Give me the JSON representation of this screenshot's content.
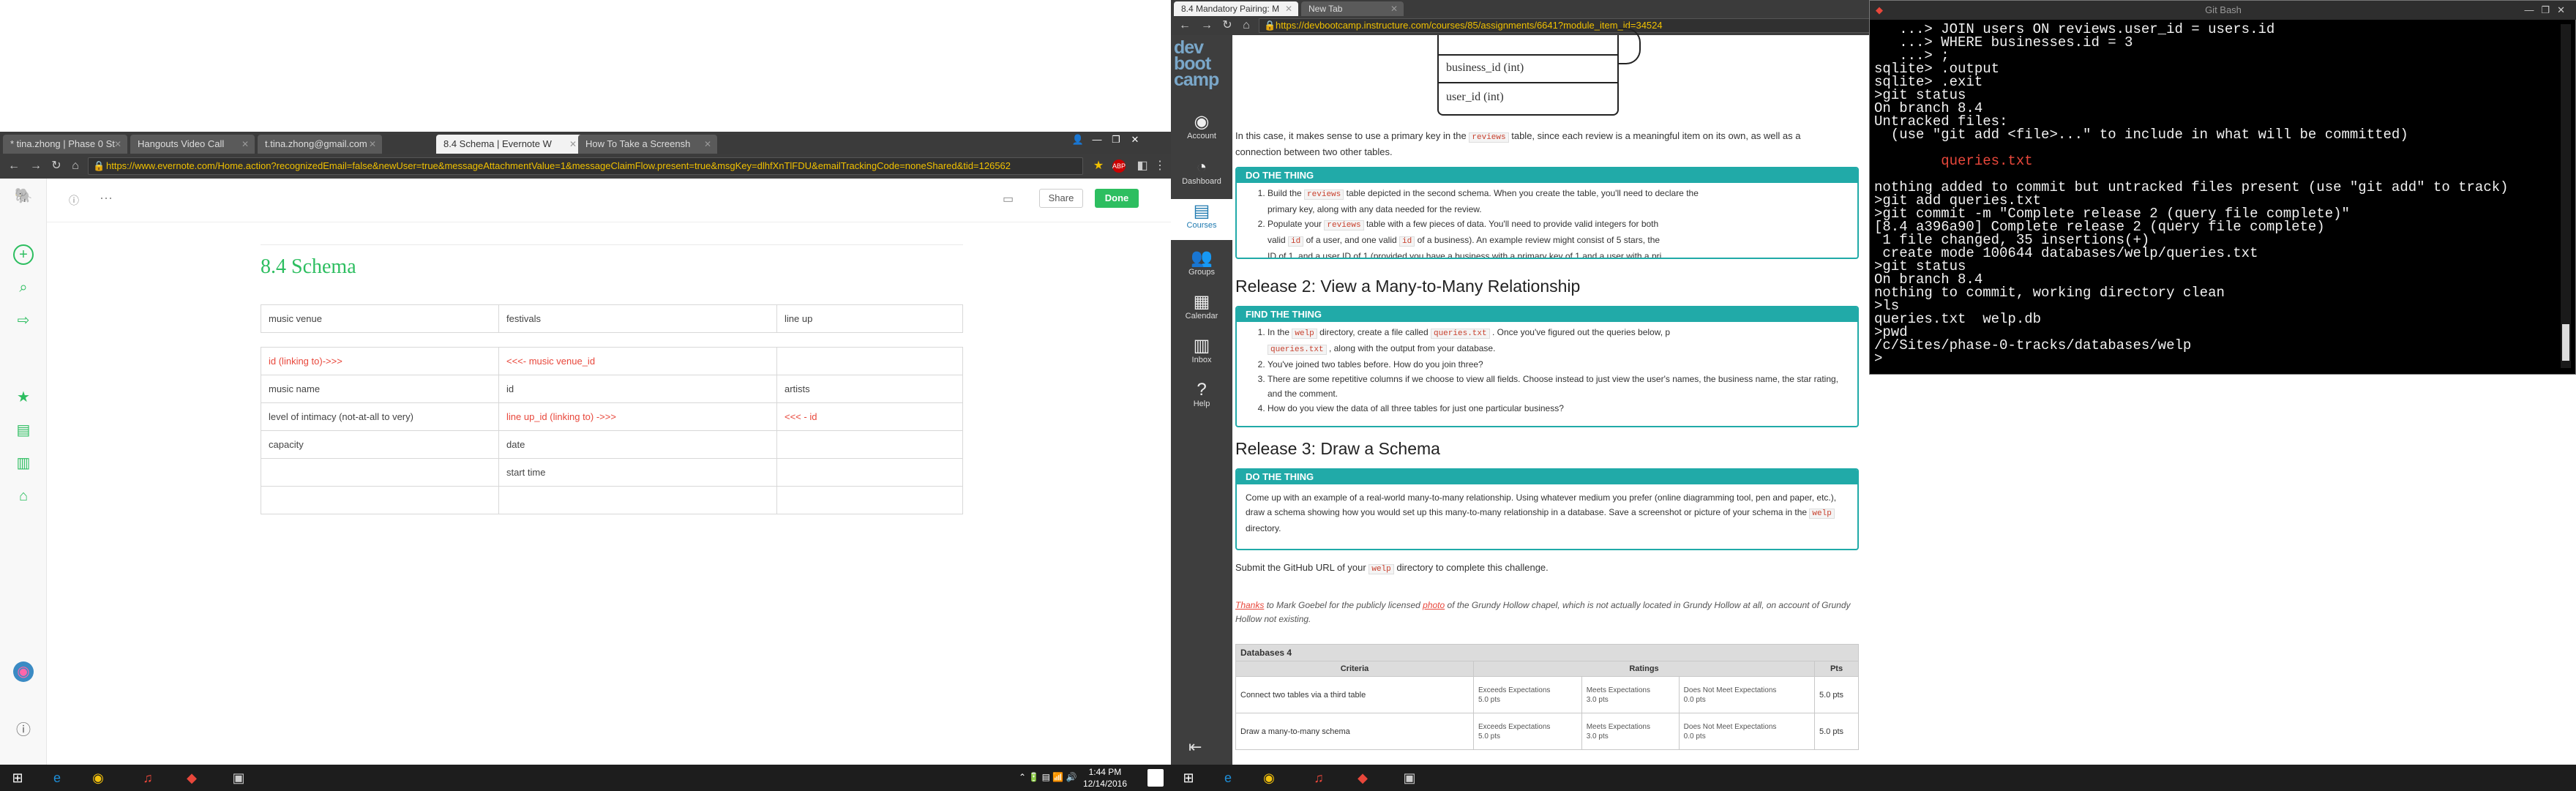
{
  "left_browser": {
    "tabs": [
      {
        "label": "* tina.zhong | Phase 0 St"
      },
      {
        "label": "Hangouts Video Call"
      },
      {
        "label": "t.tina.zhong@gmail.com"
      },
      {
        "label": "8.4 Schema | Evernote W"
      },
      {
        "label": "How To Take a Screensh"
      }
    ],
    "url": "https://www.evernote.com/Home.action?recognizedEmail=false&newUser=true&messageAttachmentValue=1&messageClaimFlow.present=true&msgKey=dlhfXnTlFDU&emailTrackingCode=noneShared&tid=126562"
  },
  "evernote": {
    "share_label": "Share",
    "done_label": "Done",
    "more_label": "···",
    "note_title": "8.4 Schema",
    "table1": [
      [
        "music venue",
        "festivals",
        "line up"
      ]
    ],
    "table2": [
      [
        "id (linking to)->>>",
        "<<<- music venue_id",
        ""
      ],
      [
        "music name",
        "id",
        "artists"
      ],
      [
        "level of intimacy (not-at-all to very)",
        "line up_id (linking to) ->>>",
        "<<< - id"
      ],
      [
        "capacity",
        "date",
        ""
      ],
      [
        "",
        "start time",
        ""
      ],
      [
        "",
        "",
        ""
      ]
    ]
  },
  "left_taskbar": {
    "time": "1:44 PM",
    "date": "12/14/2016"
  },
  "right_browser": {
    "tabs": [
      {
        "label": "8.4 Mandatory Pairing: M"
      },
      {
        "label": "New Tab"
      }
    ],
    "url": "https://devbootcamp.instructure.com/courses/85/assignments/6641?module_item_id=34524"
  },
  "canvas_nav": {
    "logo": [
      "dev",
      "boot",
      "camp"
    ],
    "items": [
      {
        "label": "Account"
      },
      {
        "label": "Dashboard"
      },
      {
        "label": "Courses"
      },
      {
        "label": "Groups"
      },
      {
        "label": "Calendar"
      },
      {
        "label": "Inbox"
      },
      {
        "label": "Help"
      }
    ]
  },
  "diagram": {
    "field1": "business_id (int)",
    "field2": "user_id (int)"
  },
  "content": {
    "intro_a": "In this case, it makes sense to use a primary key in the",
    "intro_code": "reviews",
    "intro_b": "table, since each review is a meaningful item on its own, as well as a",
    "intro_c": "connection between two other tables.",
    "box1_title": "DO THE THING",
    "box1_item1_a": "Build the",
    "box1_item1_code": "reviews",
    "box1_item1_b": "table depicted in the second schema. When you create the table, you'll need to declare the",
    "box1_item1_c": "primary key, along with any data needed for the review.",
    "box1_item2_a": "Populate your",
    "box1_item2_code": "reviews",
    "box1_item2_b": "table with a few pieces of data. You'll need to provide valid integers for both",
    "box1_item2_c": "valid",
    "box1_item2_code2": "id",
    "box1_item2_d": "of a user, and one valid",
    "box1_item2_code3": "id",
    "box1_item2_e": "of a business). An example review might consist of 5 stars, the",
    "box1_item2_f": "ID of 1, and a user ID of 1 (provided you have a business with a primary key of 1 and a user with a pri",
    "release2_heading": "Release 2: View a Many-to-Many Relationship",
    "box2_title": "FIND THE THING",
    "box2_item1_a": "In the",
    "box2_item1_code": "welp",
    "box2_item1_b": "directory, create a file called",
    "box2_item1_code2": "queries.txt",
    "box2_item1_c": ". Once you've figured out the queries below, p",
    "box2_item1_code3": "queries.txt",
    "box2_item1_d": ", along with the output from your database.",
    "box2_item2": "You've joined two tables before. How do you join three?",
    "box2_item3": "There are some repetitive columns if we choose to view all fields. Choose instead to just view the user's names, the business name, the star rating, and the comment.",
    "box2_item4": "How do you view the data of all three tables for just one particular business?",
    "release3_heading": "Release 3: Draw a Schema",
    "box3_title": "DO THE THING",
    "box3_text_a": "Come up with an example of a real-world many-to-many relationship. Using whatever medium you prefer (online diagramming tool, pen and paper, etc.), draw a schema showing how you would set up this many-to-many relationship in a database. Save a screenshot or picture of your schema in the",
    "box3_code": "welp",
    "box3_text_b": "directory.",
    "submit_a": "Submit the GitHub URL of your",
    "submit_code": "welp",
    "submit_b": "directory to complete this challenge.",
    "thanks_link": "Thanks",
    "thanks_a": "to Mark Goebel for the publicly licensed",
    "thanks_photo": "photo",
    "thanks_b": "of the Grundy Hollow chapel, which is not actually located in Grundy Hollow at all, on account of Grundy Hollow not existing."
  },
  "rubric": {
    "title": "Databases 4",
    "headers": [
      "Criteria",
      "Ratings",
      "Pts"
    ],
    "rows": [
      {
        "criteria": "Connect two tables via a third table",
        "r1": "Exceeds Expectations",
        "r1p": "5.0 pts",
        "r2": "Meets Expectations",
        "r2p": "3.0 pts",
        "r3": "Does Not Meet Expectations",
        "r3p": "0.0 pts",
        "pts": "5.0 pts"
      },
      {
        "criteria": "Draw a many-to-many schema",
        "r1": "Exceeds Expectations",
        "r1p": "5.0 pts",
        "r2": "Meets Expectations",
        "r2p": "3.0 pts",
        "r3": "Does Not Meet Expectations",
        "r3p": "0.0 pts",
        "pts": "5.0 pts"
      }
    ]
  },
  "terminal": {
    "title": "Git Bash",
    "lines": [
      "   ...> JOIN users ON reviews.user_id = users.id",
      "   ...> WHERE businesses.id = 3",
      "   ...> ;",
      "sqlite> .output",
      "sqlite> .exit",
      ">git status",
      "On branch 8.4",
      "Untracked files:",
      "  (use \"git add <file>...\" to include in what will be committed)",
      "",
      "        queries.txt",
      "",
      "nothing added to commit but untracked files present (use \"git add\" to track)",
      ">git add queries.txt",
      ">git commit -m \"Complete release 2 (query file complete)\"",
      "[8.4 a396a90] Complete release 2 (query file complete)",
      " 1 file changed, 35 insertions(+)",
      " create mode 100644 databases/welp/queries.txt",
      ">git status",
      "On branch 8.4",
      "nothing to commit, working directory clean",
      ">ls",
      "queries.txt  welp.db",
      ">pwd",
      "/c/Sites/phase-0-tracks/databases/welp",
      ">"
    ],
    "red_line_index": 10
  },
  "colors": {
    "evernote_green": "#2dbe60",
    "canvas_teal": "#21aaa8",
    "link_red": "#e8473b"
  }
}
